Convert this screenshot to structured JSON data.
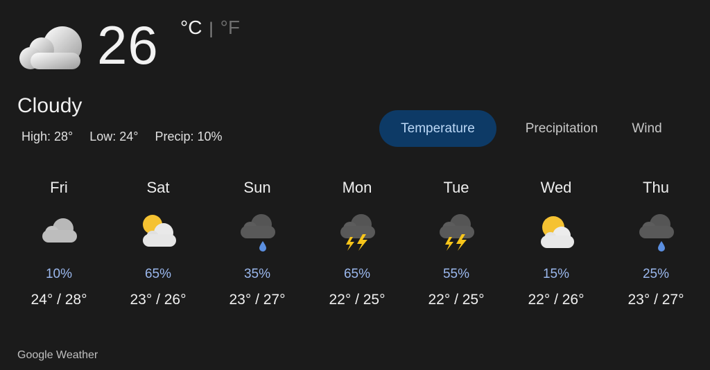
{
  "current": {
    "icon": "cloudy-icon",
    "temperature": "26",
    "unit_c": "°C",
    "unit_separator": "|",
    "unit_f": "°F",
    "condition": "Cloudy",
    "high": "High: 28°",
    "low": "Low: 24°",
    "precip": "Precip: 10%"
  },
  "tabs": [
    {
      "label": "Temperature",
      "active": true
    },
    {
      "label": "Precipitation",
      "active": false
    },
    {
      "label": "Wind",
      "active": false
    }
  ],
  "forecast": [
    {
      "day": "Fri",
      "icon": "cloudy-icon",
      "precip": "10%",
      "range": "24° / 28°"
    },
    {
      "day": "Sat",
      "icon": "partly-cloudy-icon",
      "precip": "65%",
      "range": "23° / 26°"
    },
    {
      "day": "Sun",
      "icon": "rain-icon",
      "precip": "35%",
      "range": "23° / 27°"
    },
    {
      "day": "Mon",
      "icon": "thunderstorm-icon",
      "precip": "65%",
      "range": "22° / 25°"
    },
    {
      "day": "Tue",
      "icon": "thunderstorm-icon",
      "precip": "55%",
      "range": "22° / 25°"
    },
    {
      "day": "Wed",
      "icon": "partly-cloudy-icon",
      "precip": "15%",
      "range": "22° / 26°"
    },
    {
      "day": "Thu",
      "icon": "rain-icon",
      "precip": "25%",
      "range": "23° / 27°"
    }
  ],
  "footer": "Google Weather",
  "colors": {
    "background": "#1b1b1b",
    "active_tab": "#0d3a66",
    "precip_text": "#9bb8ee",
    "sun": "#f5c232",
    "bolt": "#f7c51a",
    "rain_drop": "#5b8fe0"
  }
}
